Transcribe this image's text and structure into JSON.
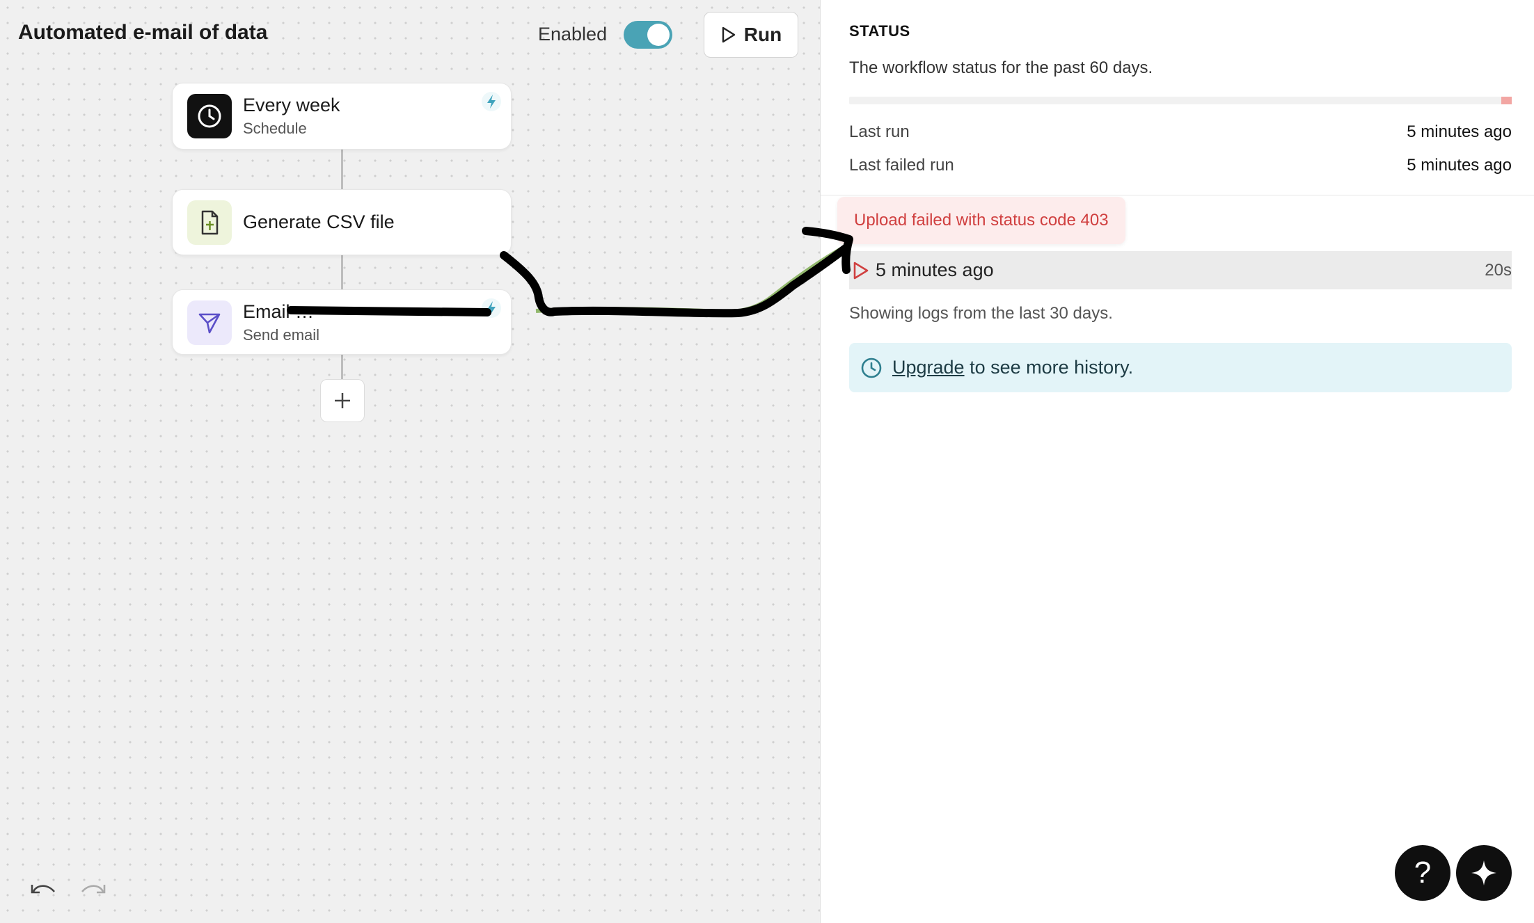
{
  "workflow": {
    "title": "Automated e-mail of data",
    "enabled_label": "Enabled",
    "enabled": true,
    "run_label": "Run"
  },
  "nodes": [
    {
      "title": "Every week",
      "subtitle": "Schedule",
      "icon": "clock-icon",
      "icon_bg": "#111111"
    },
    {
      "title": "Generate CSV file",
      "subtitle": "",
      "icon": "csv-file-icon",
      "icon_bg": "#eef4dc"
    },
    {
      "title": "Email …",
      "subtitle": "Send email",
      "icon": "send-icon",
      "icon_bg": "#ece9fb"
    }
  ],
  "status": {
    "heading": "STATUS",
    "description": "The workflow status for the past 60 days.",
    "last_run_label": "Last run",
    "last_run_value": "5 minutes ago",
    "last_failed_label": "Last failed run",
    "last_failed_value": "5 minutes ago",
    "error_tooltip": "Upload failed with status code 403",
    "log": {
      "time": "5 minutes ago",
      "duration": "20s"
    },
    "showing_text": "Showing logs from the last 30 days.",
    "upgrade_link": "Upgrade",
    "upgrade_rest": "to see more history."
  },
  "colors": {
    "accent": "#4aa3b5",
    "error": "#d04040",
    "error_bg": "#fdecec",
    "info_bg": "#e3f4f8"
  },
  "help_label": "?"
}
